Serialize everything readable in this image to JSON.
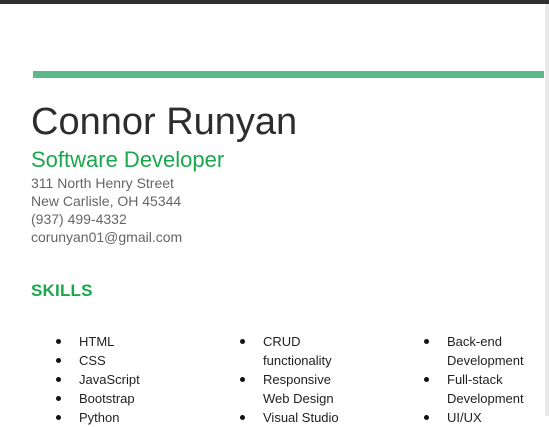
{
  "colors": {
    "accent_green": "#1aa84d",
    "rule_green": "#5bb98a"
  },
  "header": {
    "name": "Connor Runyan",
    "title": "Software Developer"
  },
  "contact": {
    "street": "311 North Henry Street",
    "city": "New Carlisle, OH 45344",
    "phone": "(937) 499-4332",
    "email": "corunyan01@gmail.com"
  },
  "skills": {
    "heading": "SKILLS",
    "columns": [
      [
        [
          "HTML"
        ],
        [
          "CSS"
        ],
        [
          "JavaScript"
        ],
        [
          "Bootstrap"
        ],
        [
          "Python"
        ]
      ],
      [
        [
          "CRUD",
          "functionality"
        ],
        [
          "Responsive",
          "Web Design"
        ],
        [
          "Visual Studio"
        ]
      ],
      [
        [
          "Back-end",
          "Development"
        ],
        [
          "Full-stack",
          "Development"
        ],
        [
          "UI/UX"
        ]
      ]
    ]
  }
}
